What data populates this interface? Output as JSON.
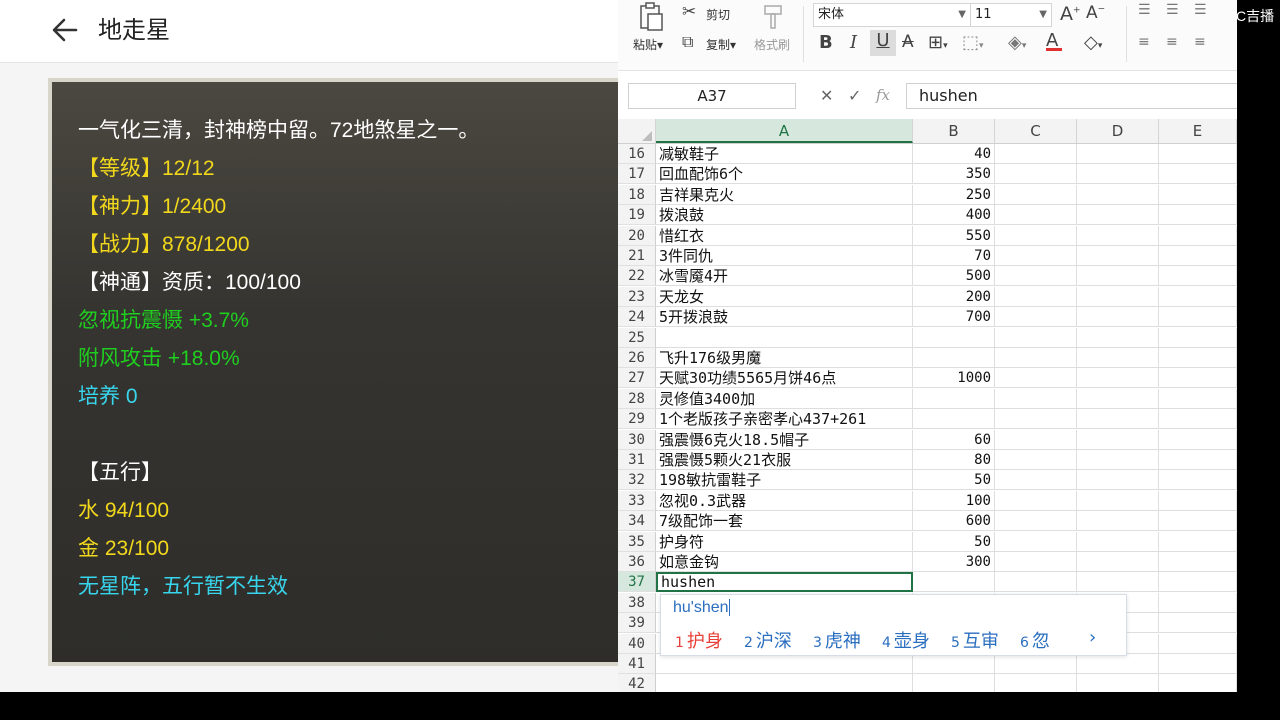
{
  "page": {
    "title": "地走星"
  },
  "card": {
    "lines": [
      {
        "text": "一气化三清，封神榜中留。72地煞星之一。",
        "color": "#ffffff"
      },
      {
        "text": "【等级】12/12",
        "color": "#f2d81c"
      },
      {
        "text": "【神力】1/2400",
        "color": "#f2d81c"
      },
      {
        "text": "【战力】878/1200",
        "color": "#f2d81c"
      },
      {
        "text": "【神通】资质：100/100",
        "color": "#ffffff"
      },
      {
        "text": "忽视抗震慑 +3.7%",
        "color": "#1fcf1f"
      },
      {
        "text": "附风攻击 +18.0%",
        "color": "#1fcf1f"
      },
      {
        "text": "培养 0",
        "color": "#38d6ee"
      },
      {
        "text": "【五行】",
        "color": "#ffffff"
      },
      {
        "text": "水 94/100",
        "color": "#f2d81c"
      },
      {
        "text": "金 23/100",
        "color": "#f2d81c"
      },
      {
        "text": "无星阵，五行暂不生效",
        "color": "#38d6ee"
      }
    ]
  },
  "ribbon": {
    "cut": "剪切",
    "copy": "复制",
    "paste": "粘贴",
    "format_painter": "格式刷",
    "font_name": "宋体",
    "font_size": "11"
  },
  "formula_bar": {
    "name_box": "A37",
    "fx": "fx",
    "value": "hushen"
  },
  "columns": [
    "A",
    "B",
    "C",
    "D",
    "E"
  ],
  "rows": [
    {
      "n": "16",
      "a": "减敏鞋子",
      "b": "40"
    },
    {
      "n": "17",
      "a": "回血配饰6个",
      "b": "350"
    },
    {
      "n": "18",
      "a": "吉祥果克火",
      "b": "250"
    },
    {
      "n": "19",
      "a": "拨浪鼓",
      "b": "400"
    },
    {
      "n": "20",
      "a": "惜红衣",
      "b": "550"
    },
    {
      "n": "21",
      "a": "3件同仇",
      "b": "70"
    },
    {
      "n": "22",
      "a": "冰雪魇4开",
      "b": "500"
    },
    {
      "n": "23",
      "a": "天龙女",
      "b": "200"
    },
    {
      "n": "24",
      "a": "5开拨浪鼓",
      "b": "700"
    },
    {
      "n": "25",
      "a": "",
      "b": ""
    },
    {
      "n": "26",
      "a": "飞升176级男魔",
      "b": ""
    },
    {
      "n": "27",
      "a": "天赋30功绩5565月饼46点",
      "b": "1000"
    },
    {
      "n": "28",
      "a": "灵修值3400加",
      "b": ""
    },
    {
      "n": "29",
      "a": "1个老版孩子亲密孝心437+261",
      "b": ""
    },
    {
      "n": "30",
      "a": "强震慑6克火18.5帽子",
      "b": "60"
    },
    {
      "n": "31",
      "a": "强震慑5颗火21衣服",
      "b": "80"
    },
    {
      "n": "32",
      "a": "198敏抗雷鞋子",
      "b": "50"
    },
    {
      "n": "33",
      "a": "忽视0.3武器",
      "b": "100"
    },
    {
      "n": "34",
      "a": "7级配饰一套",
      "b": "600"
    },
    {
      "n": "35",
      "a": "护身符",
      "b": "50"
    },
    {
      "n": "36",
      "a": "如意金钩",
      "b": "300"
    },
    {
      "n": "37",
      "a": "hushen",
      "b": ""
    },
    {
      "n": "38",
      "a": "",
      "b": ""
    },
    {
      "n": "39",
      "a": "",
      "b": ""
    },
    {
      "n": "40",
      "a": "",
      "b": ""
    },
    {
      "n": "41",
      "a": "",
      "b": ""
    },
    {
      "n": "42",
      "a": "",
      "b": ""
    }
  ],
  "ime": {
    "input": "hu'shen",
    "candidates": [
      {
        "n": "1",
        "w": "护身",
        "color": "#e8403a"
      },
      {
        "n": "2",
        "w": "沪深",
        "color": "#2a6ebf"
      },
      {
        "n": "3",
        "w": "虎神",
        "color": "#2a6ebf"
      },
      {
        "n": "4",
        "w": "壶身",
        "color": "#2a6ebf"
      },
      {
        "n": "5",
        "w": "互审",
        "color": "#2a6ebf"
      },
      {
        "n": "6",
        "w": "忽",
        "color": "#2a6ebf"
      }
    ],
    "next": "›"
  },
  "corner_label": "C吉播"
}
